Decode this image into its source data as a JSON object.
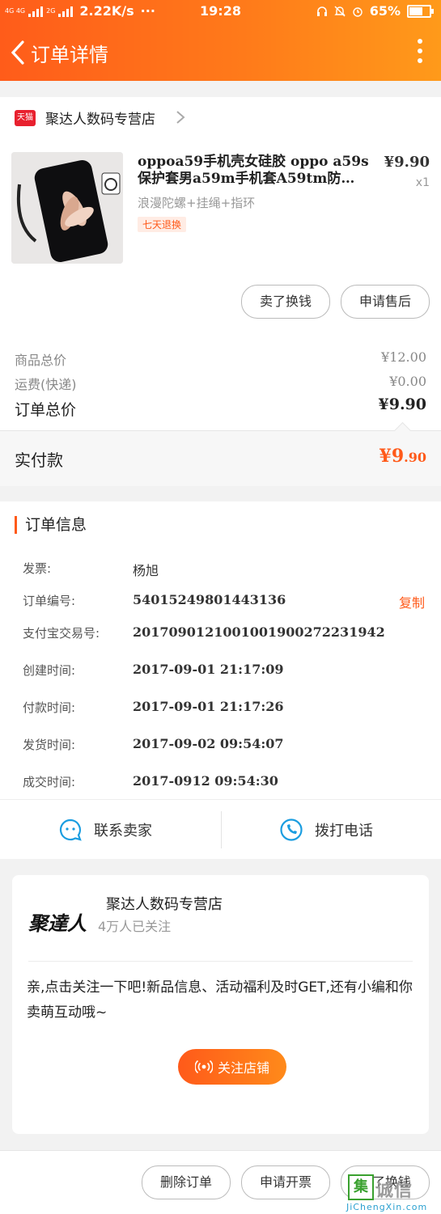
{
  "status_bar": {
    "network_small": "4G 4G",
    "network_2g": "2G",
    "speed": "2.22K/s",
    "dots": "···",
    "time": "19:28",
    "battery": "65%"
  },
  "nav": {
    "title": "订单详情"
  },
  "shop": {
    "platform_badge": "天猫",
    "name": "聚达人数码专营店"
  },
  "product": {
    "title": "oppoa59手机壳女硅胶 oppo a59s保护套男a59m手机套A59tm防…",
    "sku": "浪漫陀螺+挂绳+指环",
    "tag": "七天退换",
    "price": "¥9.90",
    "qty": "x1",
    "buttons": {
      "sell": "卖了换钱",
      "after_sale": "申请售后"
    }
  },
  "price_summary": {
    "goods_label": "商品总价",
    "goods_value": "¥12.00",
    "shipping_label": "运费(快递)",
    "shipping_value": "¥0.00",
    "total_label": "订单总价",
    "total_value": "¥9.90",
    "paid_label": "实付款",
    "paid_value_main": "¥9",
    "paid_value_decimal": ".90"
  },
  "order_info": {
    "title": "订单信息",
    "rows": [
      {
        "label": "发票:",
        "value": "杨旭"
      },
      {
        "label": "订单编号:",
        "value": "54015249801443136",
        "action": "复制"
      },
      {
        "label": "支付宝交易号:",
        "value": "2017090121001001900272231942"
      },
      {
        "label": "创建时间:",
        "value": "2017-09-01 21:17:09"
      },
      {
        "label": "付款时间:",
        "value": "2017-09-01 21:17:26"
      },
      {
        "label": "发货时间:",
        "value": "2017-09-02 09:54:07"
      },
      {
        "label": "成交时间:",
        "value": "2017-0912 09:54:30"
      }
    ],
    "contact_seller": "联系卖家",
    "call_phone": "拨打电话"
  },
  "shop_card": {
    "brand_logo": "聚達人",
    "name": "聚达人数码专营店",
    "followers": "4万人已关注",
    "desc": "亲,点击关注一下吧!新品信息、活动福利及时GET,还有小编和你卖萌互动哦~",
    "follow_button": "关注店铺"
  },
  "bottom_bar": {
    "delete_order": "删除订单",
    "apply_invoice": "申请开票",
    "sell": "卖了换钱"
  },
  "watermark": {
    "box_char": "集",
    "text": "诚信",
    "url": "JiChengXin.com"
  },
  "colors": {
    "accent": "#ff5a1a",
    "header_start": "#ff5c1a",
    "header_end": "#ff9a1a",
    "icon_blue": "#1a9de0"
  }
}
